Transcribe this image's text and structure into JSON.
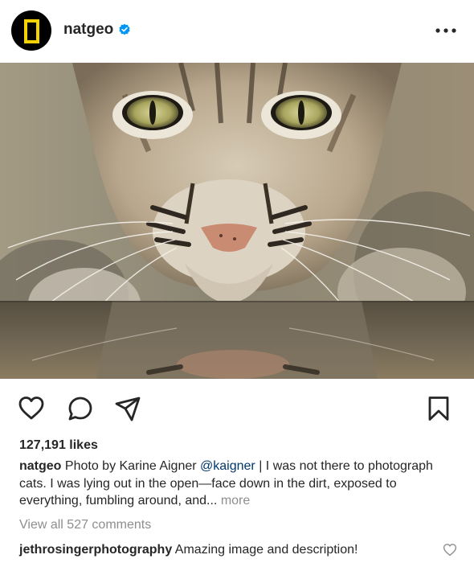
{
  "post": {
    "username": "natgeo",
    "likes": "127,191 likes",
    "caption": {
      "user": "natgeo",
      "text_before_mention": "Photo by Karine Aigner",
      "mention": "@kaigner",
      "text_after_mention": "| I was not there to photograph cats. I was lying out in the open—face down in the dirt, exposed to everything, fumbling around, and...",
      "more_label": "more"
    },
    "view_comments": "View all 527 comments",
    "comment": {
      "user": "jethrosingerphotography",
      "text": "Amazing image and description!"
    }
  },
  "colors": {
    "text": "#262626",
    "secondary": "#8e8e8e",
    "mention": "#00376b",
    "verified": "#0095f6",
    "logo_yellow": "#f5d300"
  },
  "icons": {
    "verified": "verified-badge-icon",
    "more": "more-options-icon",
    "like": "heart-icon",
    "comment": "comment-icon",
    "share": "paper-plane-icon",
    "save": "bookmark-icon",
    "comment_like": "heart-icon"
  }
}
